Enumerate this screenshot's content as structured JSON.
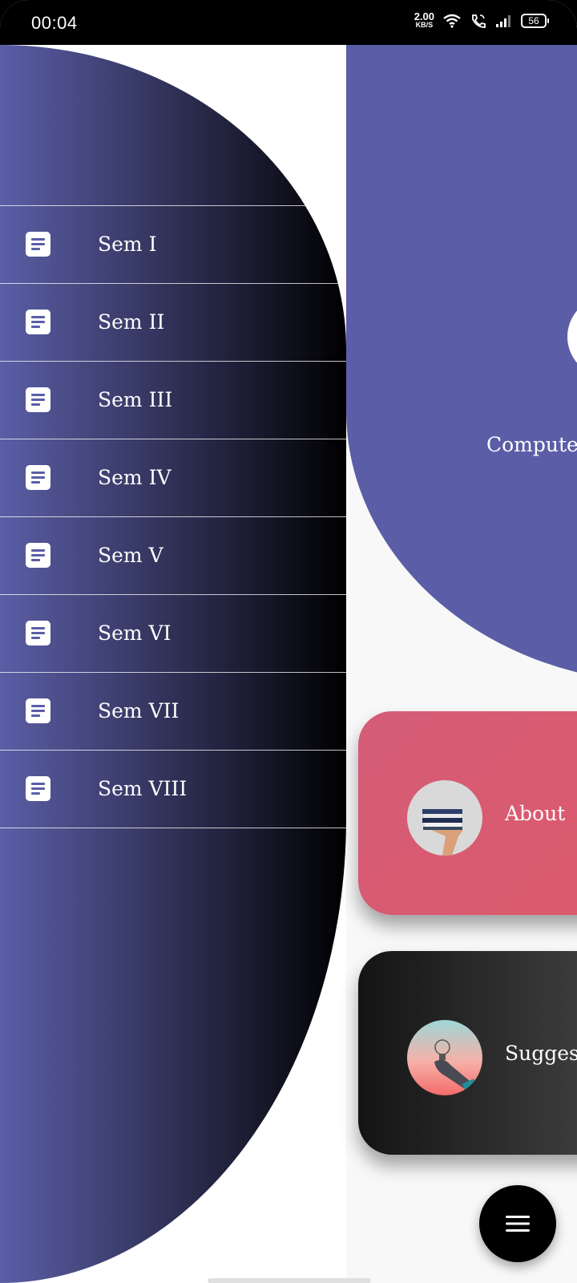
{
  "status_bar": {
    "time": "00:04",
    "net_speed_value": "2.00",
    "net_speed_unit": "KB/S",
    "battery": "56"
  },
  "drawer": {
    "items": [
      {
        "label": "Sem I",
        "icon": "document-icon"
      },
      {
        "label": "Sem II",
        "icon": "document-icon"
      },
      {
        "label": "Sem III",
        "icon": "document-icon"
      },
      {
        "label": "Sem IV",
        "icon": "document-icon"
      },
      {
        "label": "Sem V",
        "icon": "document-icon"
      },
      {
        "label": "Sem VI",
        "icon": "document-icon"
      },
      {
        "label": "Sem VII",
        "icon": "document-icon"
      },
      {
        "label": "Sem VIII",
        "icon": "document-icon"
      }
    ]
  },
  "main": {
    "header_title": "Computer",
    "cards": [
      {
        "label": "About"
      },
      {
        "label": "Suggest"
      }
    ]
  },
  "colors": {
    "accent": "#5b5ea6",
    "about_card": "#d95b6e",
    "suggest_card": "#2a2a2a"
  }
}
